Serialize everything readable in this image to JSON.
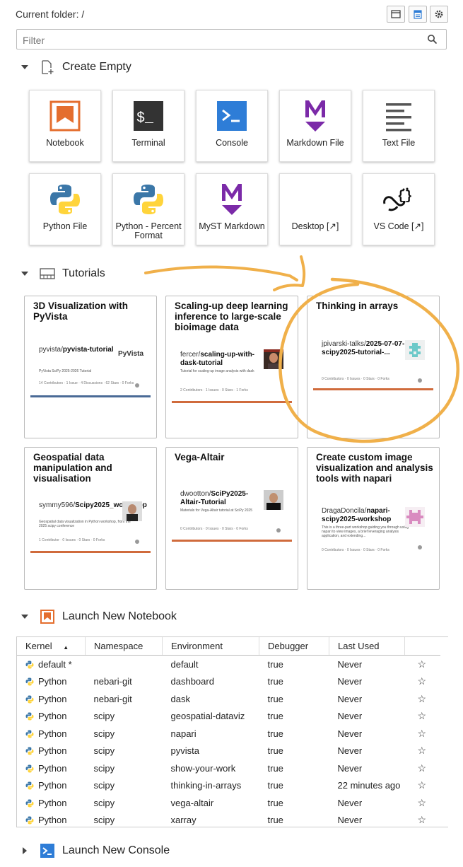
{
  "header": {
    "current_folder": "Current folder: /",
    "filter_placeholder": "Filter"
  },
  "sections": {
    "create_empty": "Create Empty",
    "tutorials": "Tutorials",
    "launch_notebook": "Launch New Notebook",
    "launch_console": "Launch New Console"
  },
  "create_cards": [
    {
      "label": "Notebook",
      "icon": "notebook-icon"
    },
    {
      "label": "Terminal",
      "icon": "terminal-icon"
    },
    {
      "label": "Console",
      "icon": "console-icon"
    },
    {
      "label": "Markdown File",
      "icon": "markdown-icon"
    },
    {
      "label": "Text File",
      "icon": "text-file-icon"
    },
    {
      "label": "Python File",
      "icon": "python-icon"
    },
    {
      "label": "Python - Percent Format",
      "icon": "python-icon"
    },
    {
      "label": "MyST Markdown",
      "icon": "myst-icon"
    },
    {
      "label": "Desktop [↗]",
      "icon": "none"
    },
    {
      "label": "VS Code [↗]",
      "icon": "vscode-icon"
    }
  ],
  "tutorials": [
    {
      "title": "3D Visualization with PyVista",
      "owner": "pyvista/",
      "repo": "pyvista-tutorial",
      "desc": "PyVista SciPy 2025-2026 Tutorial",
      "brand": "PyVista",
      "stats": [
        "14",
        "1",
        "4",
        "62",
        "0"
      ],
      "stat_labels": [
        "Contributors",
        "Issue",
        "Discussions",
        "Stars",
        "Forks"
      ],
      "bar_color": "#4a6a96"
    },
    {
      "title": "Scaling-up deep learning inference to large-scale bioimage data",
      "owner": "fercer/",
      "repo": "scaling-up-with-dask-tutorial",
      "desc": "Tutorial for scaling-up image analysis with dask",
      "stats": [
        "2",
        "1",
        "0",
        "1"
      ],
      "stat_labels": [
        "Contributors",
        "Issues",
        "Stars",
        "Forks"
      ],
      "bar_color": "#d06b3c"
    },
    {
      "title": "Thinking in arrays",
      "owner": "jpivarski-talks/",
      "repo": "2025-07-07-scipy2025-tutorial-...",
      "desc": "",
      "stats": [
        "0",
        "0",
        "0",
        "0"
      ],
      "stat_labels": [
        "Contributors",
        "Issues",
        "Stars",
        "Forks"
      ],
      "bar_color": "#d06b3c"
    },
    {
      "title": "Geospatial data manipulation and visualisation",
      "owner": "symmy596/",
      "repo": "Scipy2025_workshop",
      "desc": "Geospatial data visualization in Python workshop, from the 2025 scipy conference",
      "stats": [
        "1",
        "0",
        "0",
        "0"
      ],
      "stat_labels": [
        "Contributor",
        "Issues",
        "Stars",
        "Forks"
      ],
      "bar_color": "#d06b3c"
    },
    {
      "title": "Vega-Altair",
      "owner": "dwootton/",
      "repo": "SciPy2025-Altair-Tutorial",
      "desc": "Materials for Vega-Altair tutorial at SciPy 2025",
      "stats": [
        "0",
        "0",
        "0",
        "0"
      ],
      "stat_labels": [
        "Contributors",
        "Issues",
        "Stars",
        "Forks"
      ],
      "bar_color": "#d06b3c"
    },
    {
      "title": "Create custom image visualization and analysis tools with napari",
      "owner": "DragaDoncila/",
      "repo": "napari-scipy2025-workshop",
      "desc": "This is a three-part workshop guiding you through using napari to view images, a brief leveraging analysis application, and extending...",
      "stats": [
        "0",
        "0",
        "0",
        "0"
      ],
      "stat_labels": [
        "Contributors",
        "Issues",
        "Stars",
        "Forks"
      ],
      "bar_color": "#d06b3c"
    }
  ],
  "kernel_table": {
    "headers": [
      "Kernel",
      "Namespace",
      "Environment",
      "Debugger",
      "Last Used"
    ],
    "sort_indicator": "▲",
    "rows": [
      {
        "kernel": "default *",
        "namespace": "",
        "environment": "default",
        "debugger": "true",
        "last_used": "Never"
      },
      {
        "kernel": "Python",
        "namespace": "nebari-git",
        "environment": "dashboard",
        "debugger": "true",
        "last_used": "Never"
      },
      {
        "kernel": "Python",
        "namespace": "nebari-git",
        "environment": "dask",
        "debugger": "true",
        "last_used": "Never"
      },
      {
        "kernel": "Python",
        "namespace": "scipy",
        "environment": "geospatial-dataviz",
        "debugger": "true",
        "last_used": "Never"
      },
      {
        "kernel": "Python",
        "namespace": "scipy",
        "environment": "napari",
        "debugger": "true",
        "last_used": "Never"
      },
      {
        "kernel": "Python",
        "namespace": "scipy",
        "environment": "pyvista",
        "debugger": "true",
        "last_used": "Never"
      },
      {
        "kernel": "Python",
        "namespace": "scipy",
        "environment": "show-your-work",
        "debugger": "true",
        "last_used": "Never"
      },
      {
        "kernel": "Python",
        "namespace": "scipy",
        "environment": "thinking-in-arrays",
        "debugger": "true",
        "last_used": "22 minutes ago"
      },
      {
        "kernel": "Python",
        "namespace": "scipy",
        "environment": "vega-altair",
        "debugger": "true",
        "last_used": "Never"
      },
      {
        "kernel": "Python",
        "namespace": "scipy",
        "environment": "xarray",
        "debugger": "true",
        "last_used": "Never"
      }
    ],
    "star": "☆"
  },
  "colors": {
    "accent_orange": "#e46e2e",
    "annotation": "#f0b04a",
    "python_blue": "#3b77a8",
    "python_yellow": "#ffd43b",
    "console_blue": "#2e7dd7",
    "myst_purple": "#7b2aa8"
  }
}
